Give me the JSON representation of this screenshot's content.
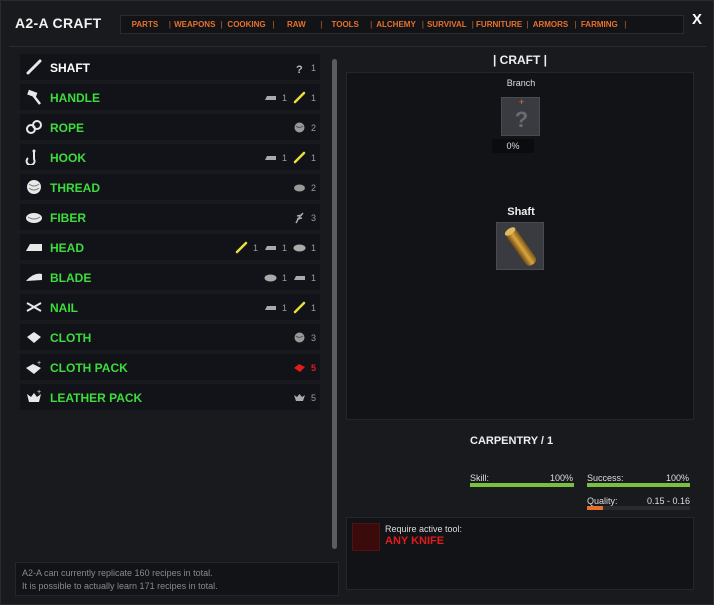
{
  "window": {
    "title": "A2-A CRAFT",
    "close_label": "X"
  },
  "tabs": [
    {
      "label": "PARTS"
    },
    {
      "label": "WEAPONS"
    },
    {
      "label": "COOKING"
    },
    {
      "label": "RAW"
    },
    {
      "label": "TOOLS"
    },
    {
      "label": "ALCHEMY"
    },
    {
      "label": "SURVIVAL"
    },
    {
      "label": "FURNITURE"
    },
    {
      "label": "ARMORS"
    },
    {
      "label": "FARMING"
    },
    {
      "label": ""
    }
  ],
  "recipes": [
    {
      "label": "SHAFT",
      "color": "#ffffff",
      "icon": "shaft-icon",
      "reqs": [
        {
          "icon": "unknown-icon",
          "qty": "1"
        }
      ]
    },
    {
      "label": "HANDLE",
      "color": "#3ddc3d",
      "icon": "hammer-icon",
      "reqs": [
        {
          "icon": "head-part-icon",
          "qty": "1"
        },
        {
          "icon": "shaft-part-icon",
          "qty": "1"
        }
      ]
    },
    {
      "label": "ROPE",
      "color": "#3ddc3d",
      "icon": "rope-icon",
      "reqs": [
        {
          "icon": "thread-part-icon",
          "qty": "2"
        }
      ]
    },
    {
      "label": "HOOK",
      "color": "#3ddc3d",
      "icon": "hook-icon",
      "reqs": [
        {
          "icon": "head-part-icon",
          "qty": "1"
        },
        {
          "icon": "shaft-part-icon",
          "qty": "1"
        }
      ]
    },
    {
      "label": "THREAD",
      "color": "#3ddc3d",
      "icon": "thread-icon",
      "reqs": [
        {
          "icon": "fiber-part-icon",
          "qty": "2"
        }
      ]
    },
    {
      "label": "FIBER",
      "color": "#3ddc3d",
      "icon": "fiber-icon",
      "reqs": [
        {
          "icon": "plant-part-icon",
          "qty": "3"
        }
      ]
    },
    {
      "label": "HEAD",
      "color": "#3ddc3d",
      "icon": "head-icon",
      "reqs": [
        {
          "icon": "shaft-part-icon",
          "qty": "1"
        },
        {
          "icon": "head-part-icon",
          "qty": "1"
        },
        {
          "icon": "stone-part-icon",
          "qty": "1"
        }
      ]
    },
    {
      "label": "BLADE",
      "color": "#3ddc3d",
      "icon": "blade-icon",
      "reqs": [
        {
          "icon": "stone-part-icon",
          "qty": "1"
        },
        {
          "icon": "head-part-icon",
          "qty": "1"
        }
      ]
    },
    {
      "label": "NAIL",
      "color": "#3ddc3d",
      "icon": "nail-icon",
      "reqs": [
        {
          "icon": "head-part-icon",
          "qty": "1"
        },
        {
          "icon": "shaft-part-icon",
          "qty": "1"
        }
      ]
    },
    {
      "label": "CLOTH",
      "color": "#3ddc3d",
      "icon": "cloth-icon",
      "reqs": [
        {
          "icon": "thread-part-icon",
          "qty": "3"
        }
      ]
    },
    {
      "label": "CLOTH PACK",
      "color": "#3ddc3d",
      "icon": "cloth-pack-icon",
      "reqs": [
        {
          "icon": "red-cloth-part-icon",
          "qty": "5",
          "alert": true
        }
      ]
    },
    {
      "label": "LEATHER PACK",
      "color": "#3ddc3d",
      "icon": "leather-pack-icon",
      "reqs": [
        {
          "icon": "leather-part-icon",
          "qty": "5"
        }
      ]
    }
  ],
  "info": {
    "line1": "A2-A can currently replicate 160 recipes in total.",
    "line2": "It is possible to actually learn  171 recipes in total."
  },
  "craft": {
    "title": "| CRAFT |",
    "ingredient_name": "Branch",
    "ingredient_plus": "+",
    "ingredient_unknown": "?",
    "ingredient_qty": "0%",
    "output_name": "Shaft"
  },
  "skill": {
    "title": "CARPENTRY / 1",
    "skill_label": "Skill:",
    "skill_value": "100%",
    "skill_fraction": 1.0,
    "success_label": "Success:",
    "success_value": "100%",
    "success_fraction": 1.0,
    "quality_label": "Quality:",
    "quality_value": "0.15 - 0.16",
    "quality_fraction": 0.16
  },
  "tool": {
    "require_label": "Require active tool:",
    "tool_name": "ANY KNIFE"
  },
  "colors": {
    "accent": "#e8702a",
    "green": "#3ddc3d",
    "red": "#e21b1b",
    "bar_green": "#7bbf3f",
    "bar_orange": "#e8702a"
  }
}
